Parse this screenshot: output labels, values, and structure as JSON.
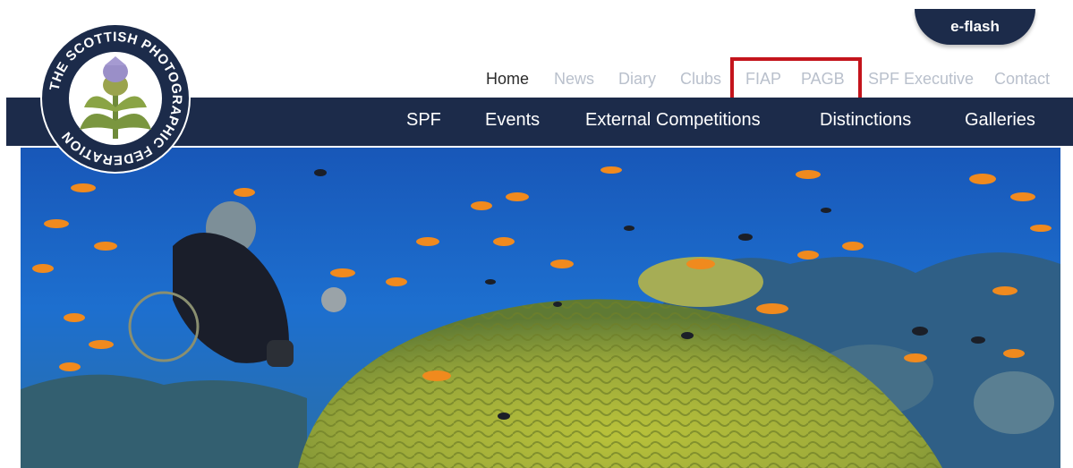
{
  "eflash": {
    "label": "e-flash"
  },
  "logo": {
    "text": "THE SCOTTISH PHOTOGRAPHIC FEDERATION"
  },
  "top_nav": {
    "items": [
      {
        "label": "Home",
        "active": true
      },
      {
        "label": "News"
      },
      {
        "label": "Diary"
      },
      {
        "label": "Clubs"
      },
      {
        "label": "FIAP"
      },
      {
        "label": "PAGB"
      },
      {
        "label": "SPF Executive"
      },
      {
        "label": "Contact"
      }
    ],
    "highlighted": [
      "FIAP",
      "PAGB"
    ],
    "highlight_color": "#c4141c"
  },
  "main_nav": {
    "items": [
      {
        "label": "SPF"
      },
      {
        "label": "Events"
      },
      {
        "label": "External Competitions"
      },
      {
        "label": "Distinctions"
      },
      {
        "label": "Galleries"
      }
    ]
  },
  "colors": {
    "navy": "#1c2b4a",
    "inactive_link": "#b9c0cc",
    "active_link": "#2b2b2b"
  },
  "hero": {
    "subject": "underwater coral reef with scuba diver and orange fish"
  }
}
